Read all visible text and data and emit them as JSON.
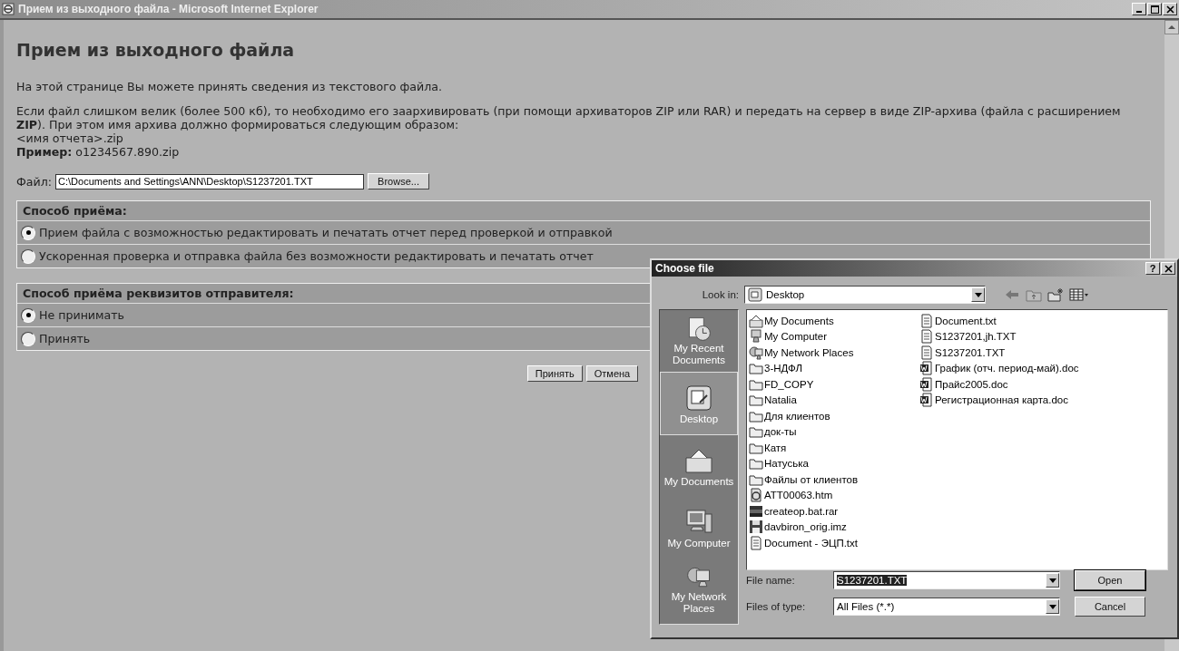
{
  "window": {
    "title": "Прием из выходного файла - Microsoft Internet Explorer"
  },
  "page": {
    "heading": "Прием из выходного файла",
    "intro": "На этой странице Вы можете принять сведения из текстового файла.",
    "note": "Если файл слишком велик (более 500 кб), то необходимо его заархивировать (при помощи архиваторов ZIP или RAR) и передать на сервер в виде ZIP-архива (файла с расширением **ZIP**). При этом имя архива должно формироваться следующим образом:",
    "pattern": "<имя отчета>.zip",
    "example": "**Пример:** o1234567.890.zip"
  },
  "file_field": {
    "label": "Файл:",
    "value": "C:\\Documents and Settings\\ANN\\Desktop\\S1237201.TXT",
    "browse": "Browse..."
  },
  "sections": [
    {
      "title": "Способ приёма:",
      "options": [
        {
          "label": "Прием файла с возможностью редактировать и печатать отчет перед проверкой и отправкой",
          "selected": true
        },
        {
          "label": "Ускоренная проверка и отправка файла без возможности редактировать и печатать отчет",
          "selected": false
        }
      ]
    },
    {
      "title": "Способ приёма реквизитов отправителя:",
      "options": [
        {
          "label": "Не принимать",
          "selected": true
        },
        {
          "label": "Принять",
          "selected": false
        }
      ]
    }
  ],
  "buttons": [
    "Принять",
    "Отмена"
  ],
  "dialog": {
    "title": "Choose file",
    "help": "?",
    "look_in_label": "Look in:",
    "look_in": "Desktop",
    "places": [
      {
        "label": "My Recent Documents",
        "kind": "recent",
        "selected": false
      },
      {
        "label": "Desktop",
        "kind": "desktop",
        "selected": true
      },
      {
        "label": "My Documents",
        "kind": "documents",
        "selected": false
      },
      {
        "label": "My Computer",
        "kind": "computer",
        "selected": false
      },
      {
        "label": "My Network Places",
        "kind": "network",
        "selected": false
      }
    ],
    "files": [
      {
        "name": "My Documents",
        "kind": "documents"
      },
      {
        "name": "My Computer",
        "kind": "computer"
      },
      {
        "name": "My Network Places",
        "kind": "network"
      },
      {
        "name": "3-НДФЛ",
        "kind": "folder"
      },
      {
        "name": "FD_COPY",
        "kind": "folder"
      },
      {
        "name": "Natalia",
        "kind": "folder"
      },
      {
        "name": "Для клиентов",
        "kind": "folder"
      },
      {
        "name": "док-ты",
        "kind": "folder"
      },
      {
        "name": "Катя",
        "kind": "folder"
      },
      {
        "name": "Натуська",
        "kind": "folder"
      },
      {
        "name": "Файлы от клиентов",
        "kind": "folder"
      },
      {
        "name": "ATT00063.htm",
        "kind": "html"
      },
      {
        "name": "createop.bat.rar",
        "kind": "archive"
      },
      {
        "name": "davbiron_orig.imz",
        "kind": "disk"
      },
      {
        "name": "Document - ЭЦП.txt",
        "kind": "text"
      },
      {
        "name": "Document.txt",
        "kind": "text"
      },
      {
        "name": "S1237201,jh.TXT",
        "kind": "text"
      },
      {
        "name": "S1237201.TXT",
        "kind": "text"
      },
      {
        "name": "График (отч. период-май).doc",
        "kind": "word"
      },
      {
        "name": "Прайс2005.doc",
        "kind": "word"
      },
      {
        "name": "Регистрационная карта.doc",
        "kind": "word"
      }
    ],
    "file_name_label": "File name:",
    "file_name": "S1237201.TXT",
    "file_name_highlighted": true,
    "type_label": "Files of type:",
    "type": "All Files (*.*)",
    "open": "Open",
    "cancel": "Cancel"
  }
}
